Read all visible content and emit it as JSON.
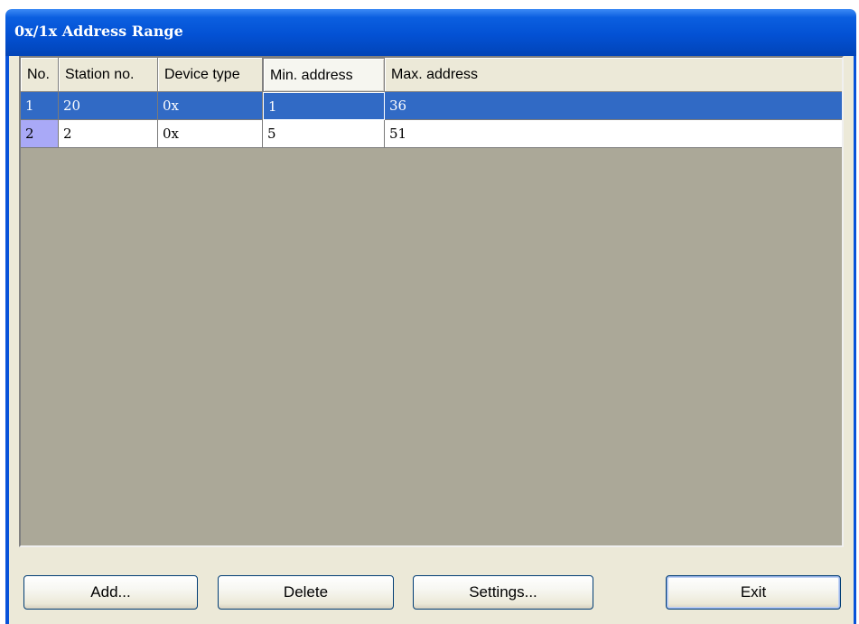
{
  "window": {
    "title": "0x/1x Address Range"
  },
  "table": {
    "columns": [
      "No.",
      "Station no.",
      "Device type",
      "Min. address",
      "Max. address"
    ],
    "rows": [
      {
        "no": "1",
        "station": "20",
        "device": "0x",
        "min": "1",
        "max": "36",
        "selected": true
      },
      {
        "no": "2",
        "station": "2",
        "device": "0x",
        "min": "5",
        "max": "51",
        "selected": false
      }
    ]
  },
  "buttons": {
    "add": "Add...",
    "delete": "Delete",
    "settings": "Settings...",
    "exit": "Exit"
  },
  "colors": {
    "titlebar": "#0351d4",
    "selection": "#316ac5",
    "grid_background": "#aba898",
    "row_number_highlight": "#a9a9f7"
  }
}
